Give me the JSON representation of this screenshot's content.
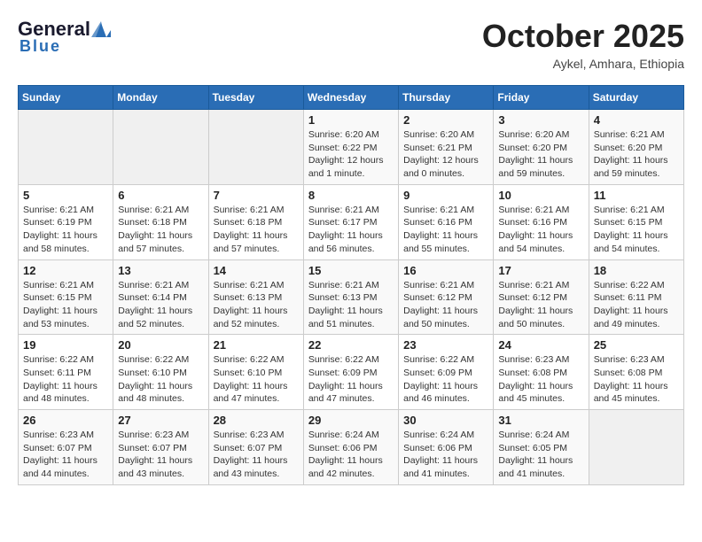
{
  "header": {
    "logo_general": "General",
    "logo_blue": "Blue",
    "month": "October 2025",
    "location": "Aykel, Amhara, Ethiopia"
  },
  "weekdays": [
    "Sunday",
    "Monday",
    "Tuesday",
    "Wednesday",
    "Thursday",
    "Friday",
    "Saturday"
  ],
  "weeks": [
    [
      {
        "day": "",
        "info": ""
      },
      {
        "day": "",
        "info": ""
      },
      {
        "day": "",
        "info": ""
      },
      {
        "day": "1",
        "info": "Sunrise: 6:20 AM\nSunset: 6:22 PM\nDaylight: 12 hours\nand 1 minute."
      },
      {
        "day": "2",
        "info": "Sunrise: 6:20 AM\nSunset: 6:21 PM\nDaylight: 12 hours\nand 0 minutes."
      },
      {
        "day": "3",
        "info": "Sunrise: 6:20 AM\nSunset: 6:20 PM\nDaylight: 11 hours\nand 59 minutes."
      },
      {
        "day": "4",
        "info": "Sunrise: 6:21 AM\nSunset: 6:20 PM\nDaylight: 11 hours\nand 59 minutes."
      }
    ],
    [
      {
        "day": "5",
        "info": "Sunrise: 6:21 AM\nSunset: 6:19 PM\nDaylight: 11 hours\nand 58 minutes."
      },
      {
        "day": "6",
        "info": "Sunrise: 6:21 AM\nSunset: 6:18 PM\nDaylight: 11 hours\nand 57 minutes."
      },
      {
        "day": "7",
        "info": "Sunrise: 6:21 AM\nSunset: 6:18 PM\nDaylight: 11 hours\nand 57 minutes."
      },
      {
        "day": "8",
        "info": "Sunrise: 6:21 AM\nSunset: 6:17 PM\nDaylight: 11 hours\nand 56 minutes."
      },
      {
        "day": "9",
        "info": "Sunrise: 6:21 AM\nSunset: 6:16 PM\nDaylight: 11 hours\nand 55 minutes."
      },
      {
        "day": "10",
        "info": "Sunrise: 6:21 AM\nSunset: 6:16 PM\nDaylight: 11 hours\nand 54 minutes."
      },
      {
        "day": "11",
        "info": "Sunrise: 6:21 AM\nSunset: 6:15 PM\nDaylight: 11 hours\nand 54 minutes."
      }
    ],
    [
      {
        "day": "12",
        "info": "Sunrise: 6:21 AM\nSunset: 6:15 PM\nDaylight: 11 hours\nand 53 minutes."
      },
      {
        "day": "13",
        "info": "Sunrise: 6:21 AM\nSunset: 6:14 PM\nDaylight: 11 hours\nand 52 minutes."
      },
      {
        "day": "14",
        "info": "Sunrise: 6:21 AM\nSunset: 6:13 PM\nDaylight: 11 hours\nand 52 minutes."
      },
      {
        "day": "15",
        "info": "Sunrise: 6:21 AM\nSunset: 6:13 PM\nDaylight: 11 hours\nand 51 minutes."
      },
      {
        "day": "16",
        "info": "Sunrise: 6:21 AM\nSunset: 6:12 PM\nDaylight: 11 hours\nand 50 minutes."
      },
      {
        "day": "17",
        "info": "Sunrise: 6:21 AM\nSunset: 6:12 PM\nDaylight: 11 hours\nand 50 minutes."
      },
      {
        "day": "18",
        "info": "Sunrise: 6:22 AM\nSunset: 6:11 PM\nDaylight: 11 hours\nand 49 minutes."
      }
    ],
    [
      {
        "day": "19",
        "info": "Sunrise: 6:22 AM\nSunset: 6:11 PM\nDaylight: 11 hours\nand 48 minutes."
      },
      {
        "day": "20",
        "info": "Sunrise: 6:22 AM\nSunset: 6:10 PM\nDaylight: 11 hours\nand 48 minutes."
      },
      {
        "day": "21",
        "info": "Sunrise: 6:22 AM\nSunset: 6:10 PM\nDaylight: 11 hours\nand 47 minutes."
      },
      {
        "day": "22",
        "info": "Sunrise: 6:22 AM\nSunset: 6:09 PM\nDaylight: 11 hours\nand 47 minutes."
      },
      {
        "day": "23",
        "info": "Sunrise: 6:22 AM\nSunset: 6:09 PM\nDaylight: 11 hours\nand 46 minutes."
      },
      {
        "day": "24",
        "info": "Sunrise: 6:23 AM\nSunset: 6:08 PM\nDaylight: 11 hours\nand 45 minutes."
      },
      {
        "day": "25",
        "info": "Sunrise: 6:23 AM\nSunset: 6:08 PM\nDaylight: 11 hours\nand 45 minutes."
      }
    ],
    [
      {
        "day": "26",
        "info": "Sunrise: 6:23 AM\nSunset: 6:07 PM\nDaylight: 11 hours\nand 44 minutes."
      },
      {
        "day": "27",
        "info": "Sunrise: 6:23 AM\nSunset: 6:07 PM\nDaylight: 11 hours\nand 43 minutes."
      },
      {
        "day": "28",
        "info": "Sunrise: 6:23 AM\nSunset: 6:07 PM\nDaylight: 11 hours\nand 43 minutes."
      },
      {
        "day": "29",
        "info": "Sunrise: 6:24 AM\nSunset: 6:06 PM\nDaylight: 11 hours\nand 42 minutes."
      },
      {
        "day": "30",
        "info": "Sunrise: 6:24 AM\nSunset: 6:06 PM\nDaylight: 11 hours\nand 41 minutes."
      },
      {
        "day": "31",
        "info": "Sunrise: 6:24 AM\nSunset: 6:05 PM\nDaylight: 11 hours\nand 41 minutes."
      },
      {
        "day": "",
        "info": ""
      }
    ]
  ]
}
